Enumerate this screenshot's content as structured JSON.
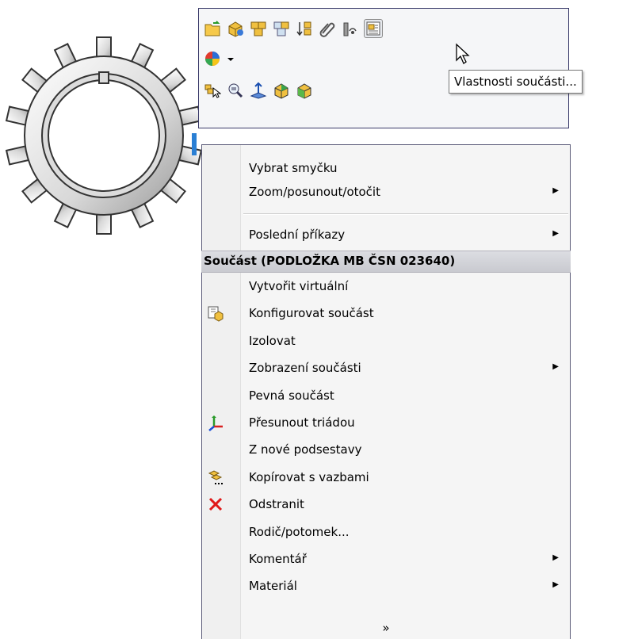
{
  "tooltip": "Vlastnosti součásti...",
  "toolbar": {
    "row1": [
      "smart-mates-icon",
      "edit-part-icon",
      "hide-components-icon",
      "show-components-icon",
      "component-order-icon",
      "mate-icon",
      "sensor-icon",
      "part-properties-icon"
    ],
    "row2": [
      "appearance-icon",
      "dropdown-arrow-icon"
    ],
    "row3": [
      "select-other-icon",
      "zoom-to-selection-icon",
      "normal-to-icon",
      "isolate-icon",
      "transparency-icon"
    ]
  },
  "menu": {
    "items1": [
      {
        "label": "Vybrat smyčku",
        "submenu": false
      },
      {
        "label": "Zoom/posunout/otočit",
        "submenu": true
      }
    ],
    "items2": [
      {
        "label": "Poslední příkazy",
        "submenu": true
      }
    ],
    "section": "Součást (PODLOŽKA MB ČSN 023640)",
    "items3": [
      {
        "label": "Vytvořit virtuální",
        "submenu": false,
        "icon": ""
      },
      {
        "label": "Konfigurovat součást",
        "submenu": false,
        "icon": "configure-part-icon"
      },
      {
        "label": "Izolovat",
        "submenu": false,
        "icon": ""
      },
      {
        "label": "Zobrazení součásti",
        "submenu": true,
        "icon": ""
      },
      {
        "label": "Pevná součást",
        "submenu": false,
        "icon": ""
      },
      {
        "label": "Přesunout triádou",
        "submenu": false,
        "icon": "triad-icon"
      },
      {
        "label": "Z nové podsestavy",
        "submenu": false,
        "icon": ""
      },
      {
        "label": "Kopírovat s vazbami",
        "submenu": false,
        "icon": "copy-with-mates-icon"
      },
      {
        "label": "Odstranit",
        "submenu": false,
        "icon": "delete-icon"
      },
      {
        "label": "Rodič/potomek...",
        "submenu": false,
        "icon": ""
      },
      {
        "label": "Komentář",
        "submenu": true,
        "icon": ""
      },
      {
        "label": "Materiál",
        "submenu": true,
        "icon": ""
      }
    ],
    "more": "»"
  }
}
